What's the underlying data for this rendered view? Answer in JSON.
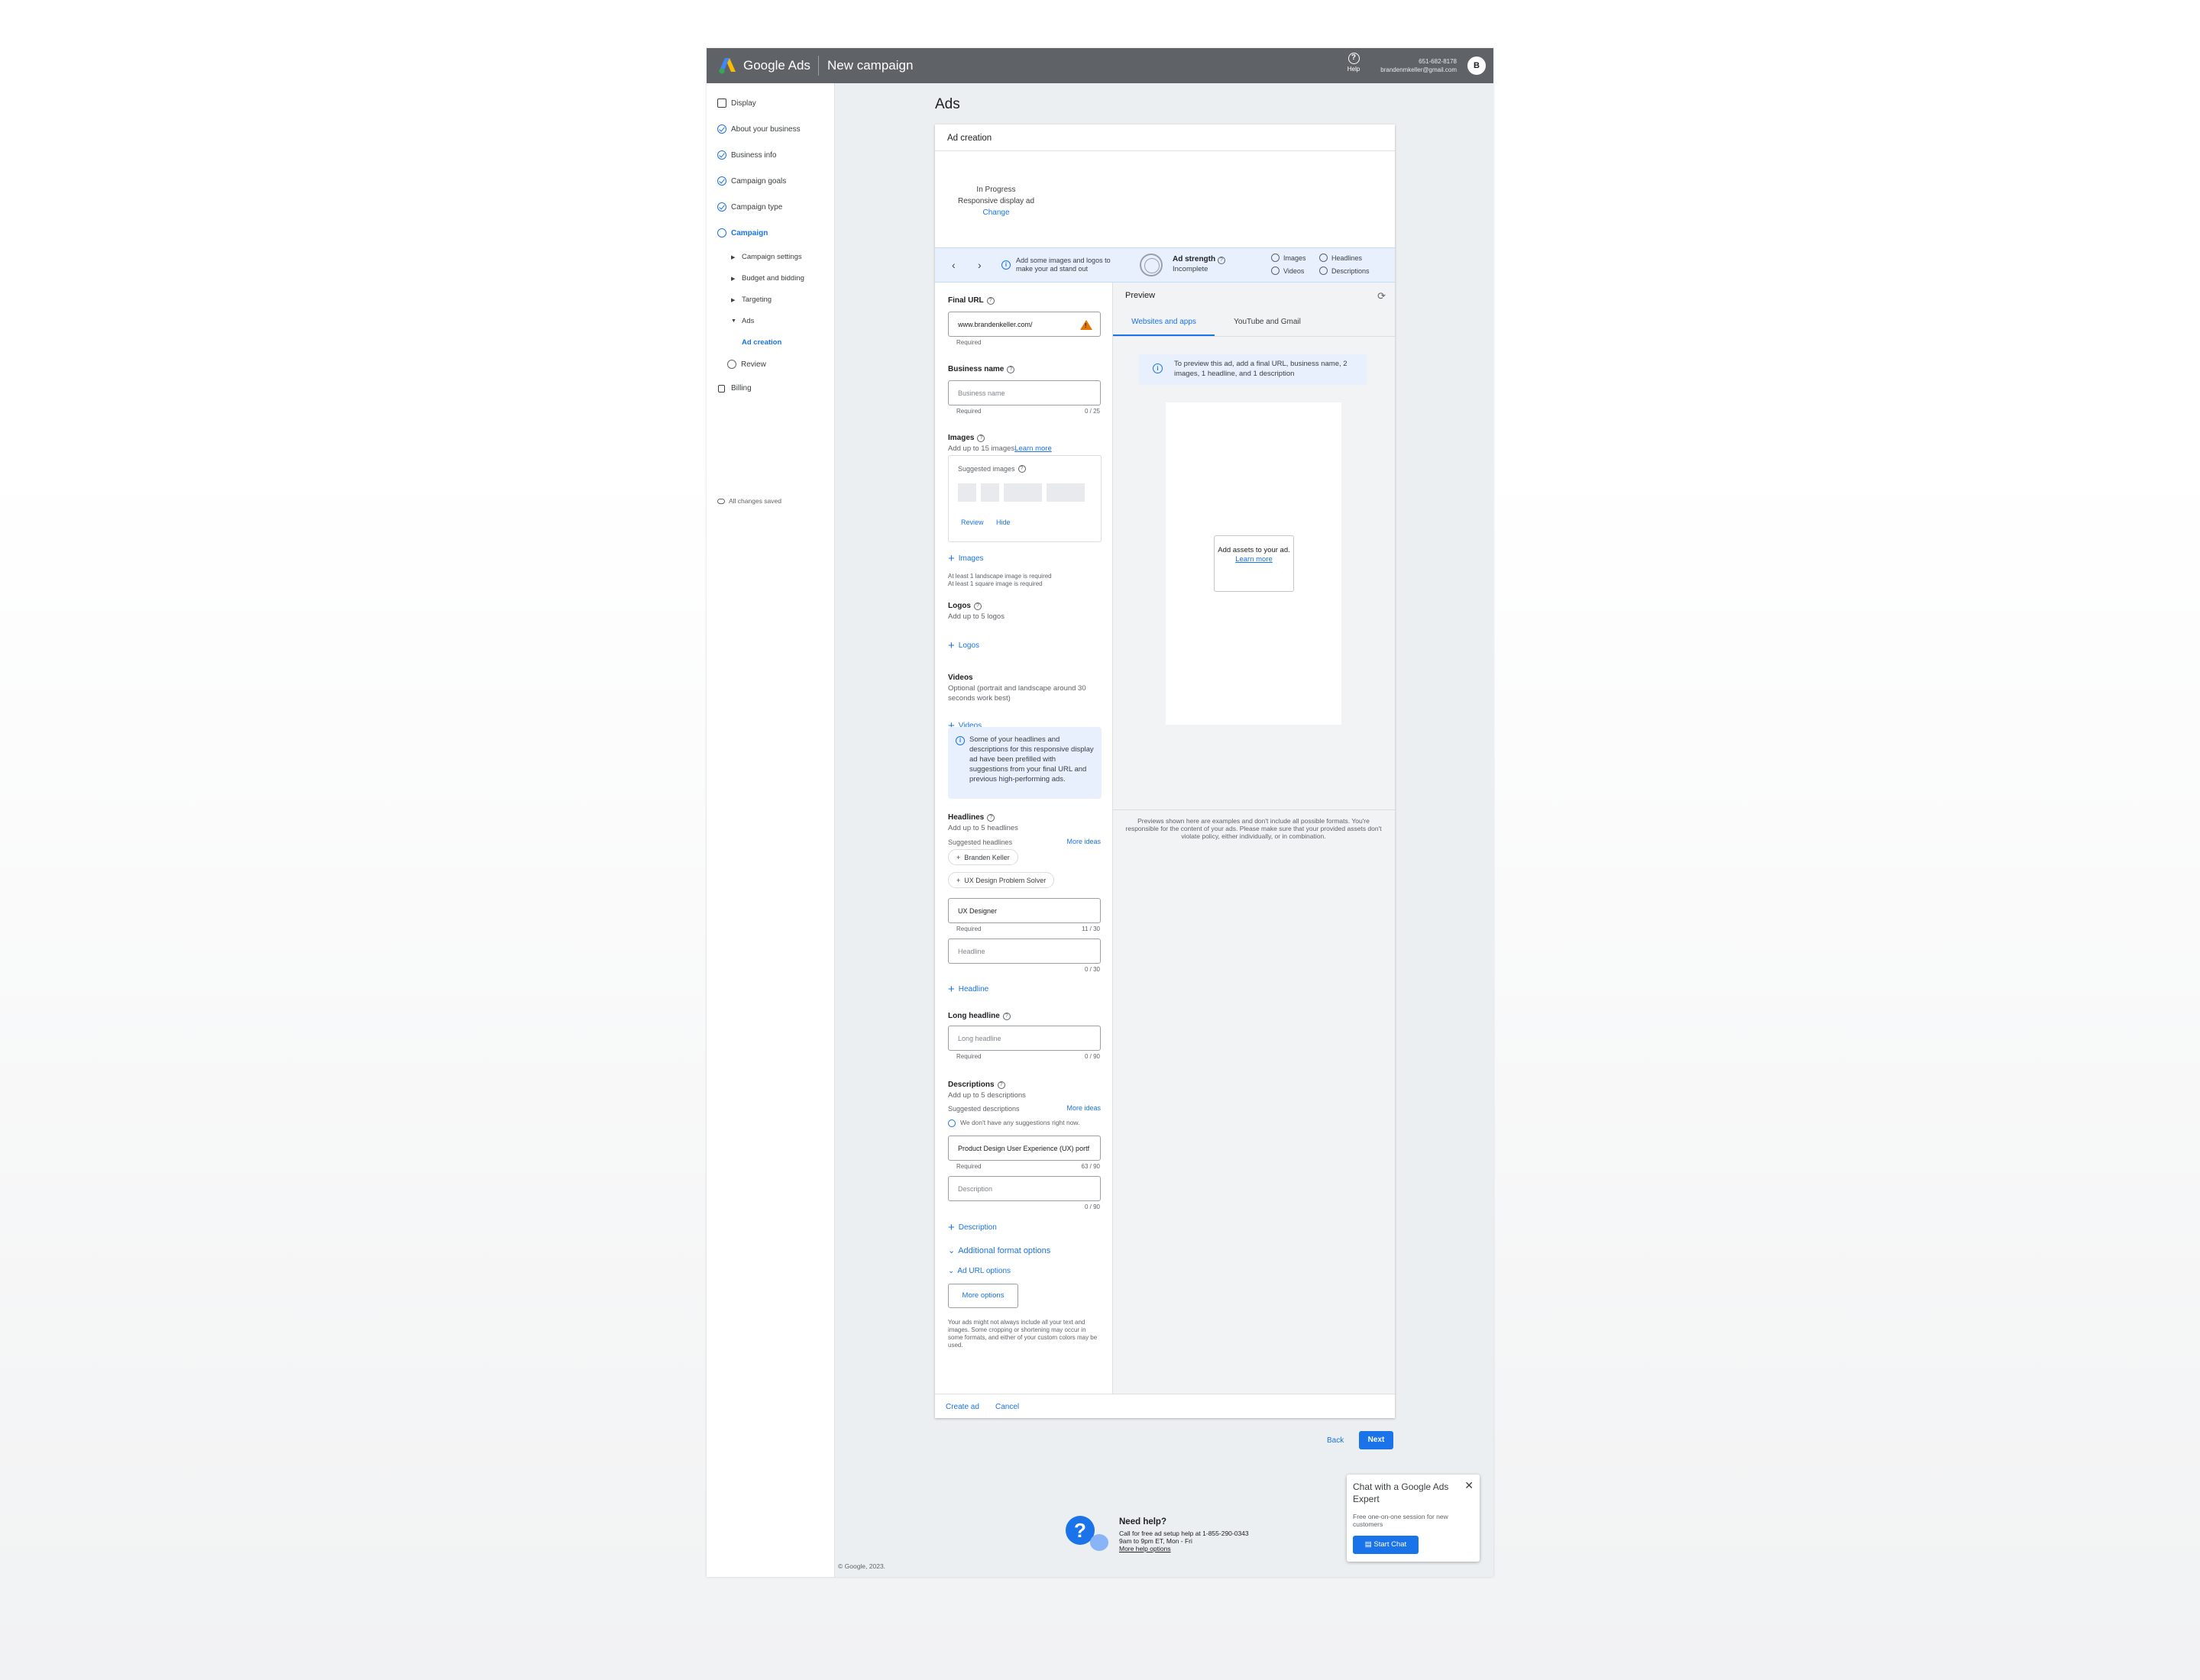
{
  "header": {
    "brand": "Google Ads",
    "campaign_title": "New campaign",
    "help_label": "Help",
    "phone": "651-682-8178",
    "email": "brandenmkeller@gmail.com"
  },
  "sidebar": {
    "items": [
      {
        "label": "Display"
      },
      {
        "label": "About your business"
      },
      {
        "label": "Business info"
      },
      {
        "label": "Campaign goals"
      },
      {
        "label": "Campaign type"
      },
      {
        "label": "Campaign"
      }
    ],
    "sub_items": [
      {
        "label": "Campaign settings"
      },
      {
        "label": "Budget and bidding"
      },
      {
        "label": "Targeting"
      },
      {
        "label": "Ads"
      },
      {
        "label": "Ad creation"
      }
    ],
    "review": "Review",
    "billing": "Billing",
    "saved": "All changes saved"
  },
  "page": {
    "title": "Ads",
    "copyright": "© Google, 2023."
  },
  "card": {
    "title": "Ad creation",
    "status": "In Progress",
    "ad_type": "Responsive display ad",
    "change": "Change"
  },
  "strength": {
    "tip": "Add some images and logos to make your ad stand out",
    "title": "Ad strength",
    "status": "Incomplete",
    "checks": [
      "Images",
      "Headlines",
      "Videos",
      "Descriptions"
    ]
  },
  "form": {
    "final_url": {
      "label": "Final URL",
      "value": "www.brandenkeller.com/",
      "hint": "Required"
    },
    "business_name": {
      "label": "Business name",
      "placeholder": "Business name",
      "hint": "Required",
      "count": "0 / 25"
    },
    "images": {
      "label": "Images",
      "sub": "Add up to 15 images",
      "learn_more": "Learn more",
      "suggested": "Suggested images",
      "review": "Review",
      "hide": "Hide",
      "add": "Images",
      "req1": "At least 1 landscape image is required",
      "req2": "At least 1 square image is required"
    },
    "logos": {
      "label": "Logos",
      "sub": "Add up to 5 logos",
      "add": "Logos"
    },
    "videos": {
      "label": "Videos",
      "sub": "Optional (portrait and landscape around 30 seconds work best)",
      "add": "Videos"
    },
    "prefill_info": "Some of your headlines and descriptions for this responsive display ad have been prefilled with suggestions from your final URL and previous high-performing ads.",
    "headlines": {
      "label": "Headlines",
      "sub": "Add up to 5 headlines",
      "suggested": "Suggested headlines",
      "more_ideas": "More ideas",
      "chips": [
        "Branden Keller",
        "UX Design Problem Solver"
      ],
      "value1": "UX Designer",
      "hint1": "Required",
      "count1": "11 / 30",
      "placeholder2": "Headline",
      "count2": "0 / 30",
      "add": "Headline"
    },
    "long_headline": {
      "label": "Long headline",
      "placeholder": "Long headline",
      "hint": "Required",
      "count": "0 / 90"
    },
    "descriptions": {
      "label": "Descriptions",
      "sub": "Add up to 5 descriptions",
      "suggested": "Suggested descriptions",
      "more_ideas": "More ideas",
      "none": "We don't have any suggestions right now.",
      "value1": "Product Design User Experience (UX) portf",
      "hint1": "Required",
      "count1": "63 / 90",
      "placeholder2": "Description",
      "count2": "0 / 90",
      "add": "Description"
    },
    "additional_format": "Additional format options",
    "ad_url_options": "Ad URL options",
    "more_options": "More options",
    "note": "Your ads might not always include all your text and images. Some cropping or shortening may occur in some formats, and either of your custom colors may be used."
  },
  "footer": {
    "create": "Create ad",
    "cancel": "Cancel",
    "back": "Back",
    "next": "Next"
  },
  "preview": {
    "title": "Preview",
    "tabs": [
      "Websites and apps",
      "YouTube and Gmail"
    ],
    "info": "To preview this ad, add a final URL, business name, 2 images, 1 headline, and 1 description",
    "assets": "Add assets to your ad.",
    "learn_more": "Learn more",
    "disclaimer": "Previews shown here are examples and don't include all possible formats. You're responsible for the content of your ads. Please make sure that your provided assets don't violate policy, either individually, or in combination."
  },
  "help_block": {
    "title": "Need help?",
    "line1": "Call for free ad setup help at 1-855-290-0343",
    "line2": "9am to 9pm ET, Mon - Fri",
    "link": "More help options"
  },
  "chat": {
    "title": "Chat with a Google Ads Expert",
    "sub": "Free one-on-one session for new customers",
    "button": "Start Chat"
  }
}
